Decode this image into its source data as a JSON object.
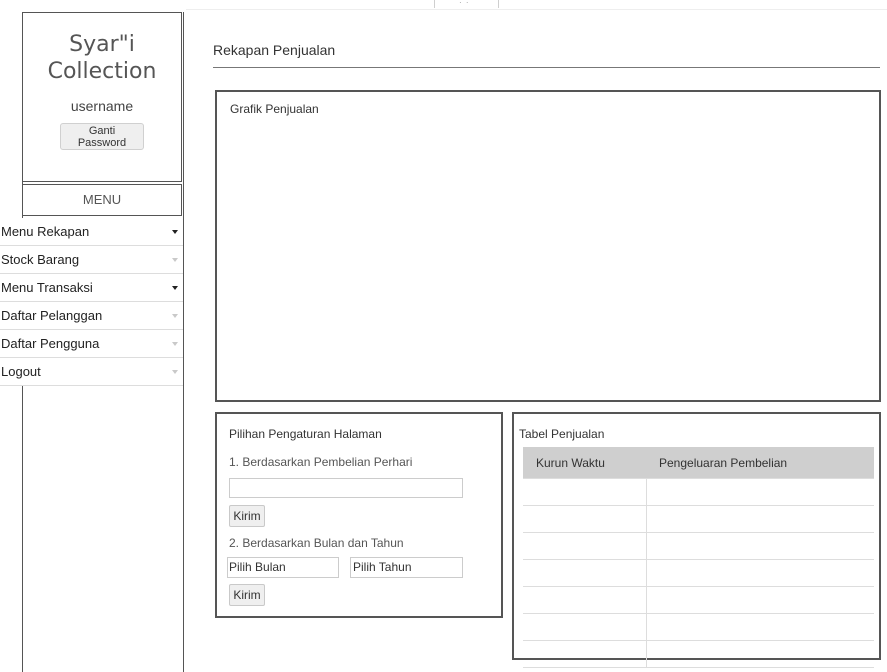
{
  "sidebar": {
    "brand_line1": "Syar\"i",
    "brand_line2": "Collection",
    "username": "username",
    "change_password_label": "Ganti Password",
    "menu_header": "MENU",
    "items": [
      {
        "label": "Menu Rekapan",
        "caret": "dark"
      },
      {
        "label": "Stock Barang",
        "caret": "light"
      },
      {
        "label": "Menu Transaksi",
        "caret": "dark"
      },
      {
        "label": "Daftar Pelanggan",
        "caret": "light"
      },
      {
        "label": "Daftar Pengguna",
        "caret": "light"
      },
      {
        "label": "Logout",
        "caret": "light"
      }
    ]
  },
  "main": {
    "page_title": "Rekapan Penjualan",
    "chart_panel": {
      "label": "Grafik Penjualan"
    },
    "settings_panel": {
      "label": "Pilihan Pengaturan Halaman",
      "option1": "1. Berdasarkan Pembelian Perhari",
      "date_value": "",
      "submit1": "Kirim",
      "option2": "2. Berdasarkan Bulan dan Tahun",
      "month_select": "Pilih Bulan",
      "year_select": "Pilih Tahun",
      "submit2": "Kirim"
    },
    "table_panel": {
      "label": "Tabel Penjualan",
      "columns": [
        "Kurun Waktu",
        "Pengeluaran Pembelian"
      ],
      "rows": [
        [
          "",
          ""
        ],
        [
          "",
          ""
        ],
        [
          "",
          ""
        ],
        [
          "",
          ""
        ],
        [
          "",
          ""
        ],
        [
          "",
          ""
        ],
        [
          "",
          ""
        ]
      ]
    }
  },
  "colors": {
    "border": "#555555",
    "table_header_bg": "#cfcfcf",
    "button_bg": "#efefef"
  },
  "icons": {
    "menu_caret": "caret-down-icon"
  }
}
